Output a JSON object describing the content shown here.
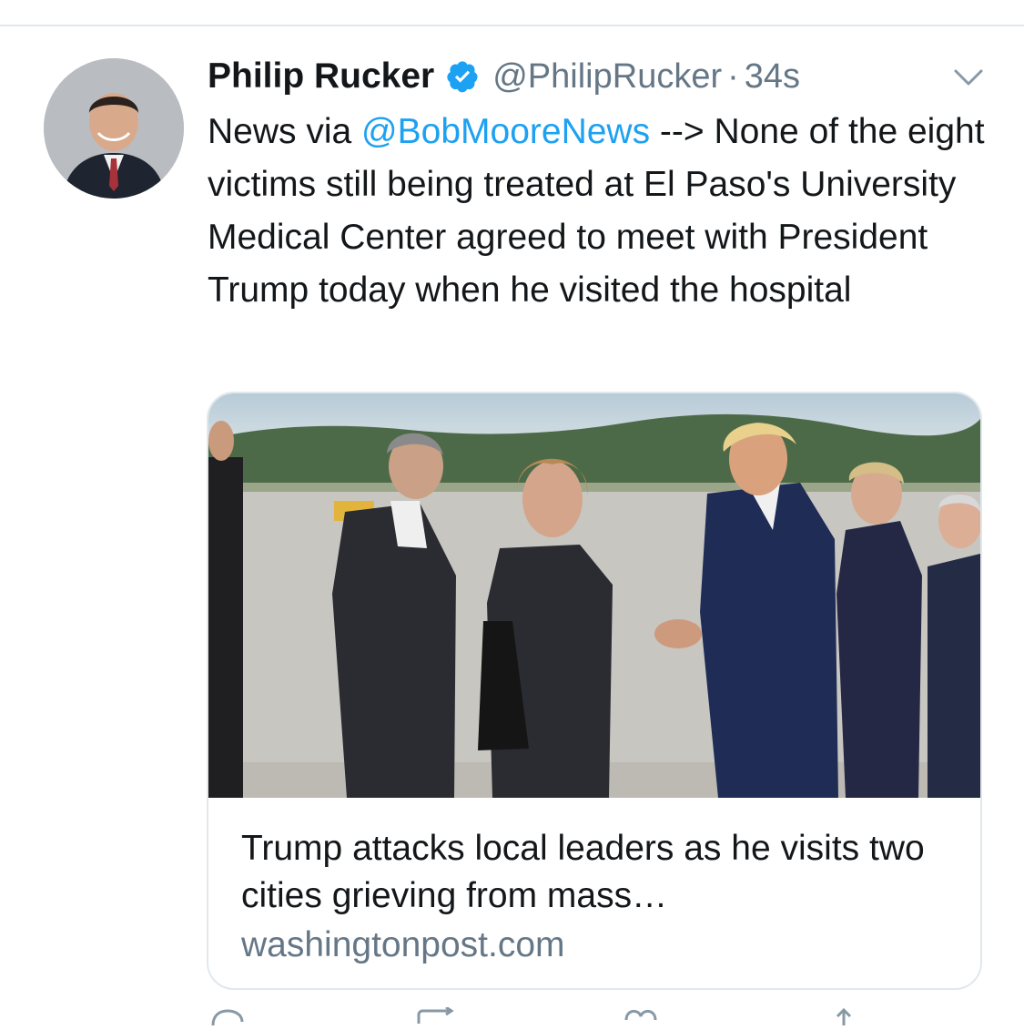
{
  "tweet": {
    "author": {
      "display_name": "Philip Rucker",
      "handle": "@PhilipRucker",
      "verified": true
    },
    "separator": "·",
    "timestamp": "34s",
    "text": {
      "prefix": "News via ",
      "mention": "@BobMooreNews",
      "suffix": " --> None of the eight victims still being treated at El Paso's University Medical Center agreed to meet with President Trump today when he visited the hospital"
    },
    "card": {
      "title": "Trump attacks local leaders as he visits two cities grieving from mass…",
      "domain": "washingtonpost.com"
    }
  },
  "icons": {
    "verified": "verified-badge-icon",
    "caret": "chevron-down-icon",
    "reply": "reply-icon",
    "retweet": "retweet-icon",
    "like": "heart-icon",
    "share": "share-icon"
  },
  "colors": {
    "accent": "#1da1f2",
    "secondary_text": "#657786",
    "border": "#e1e8ed"
  }
}
